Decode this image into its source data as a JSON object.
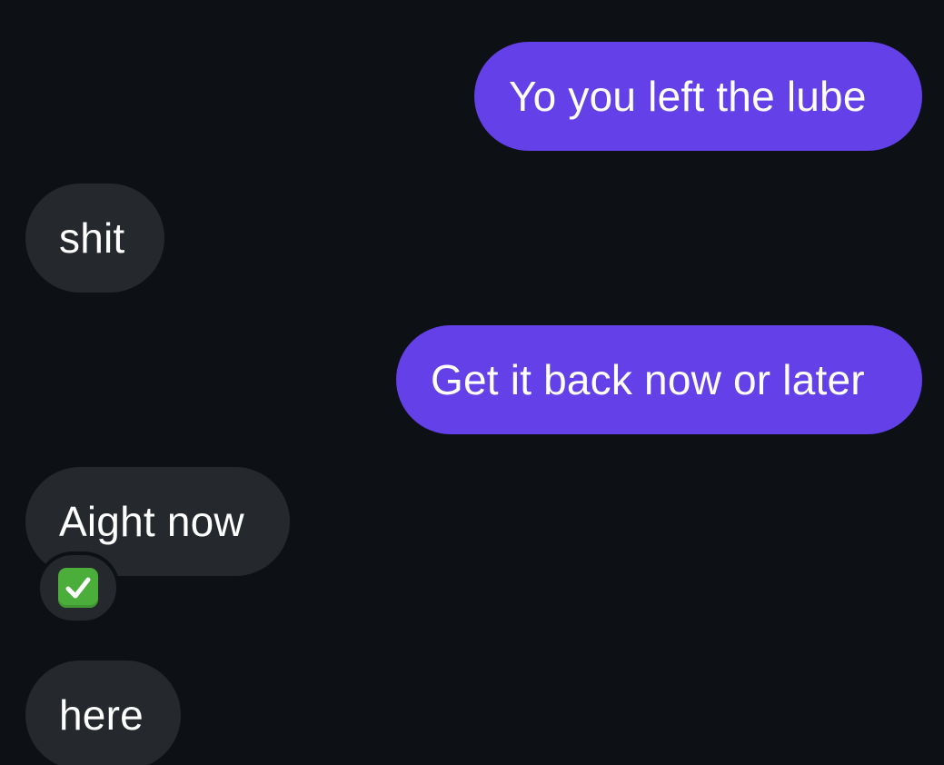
{
  "messages": [
    {
      "direction": "outgoing",
      "text": "Yo you left the lube"
    },
    {
      "direction": "incoming",
      "text": "shit"
    },
    {
      "direction": "outgoing",
      "text": "Get it back now or later"
    },
    {
      "direction": "incoming",
      "text": "Aight now",
      "reaction": "check-mark-button"
    },
    {
      "direction": "incoming",
      "text": "here"
    }
  ],
  "colors": {
    "background": "#0d1014",
    "outgoing_bubble": "#6440e8",
    "incoming_bubble": "#25282c",
    "reaction_check": "#4cae3a"
  }
}
